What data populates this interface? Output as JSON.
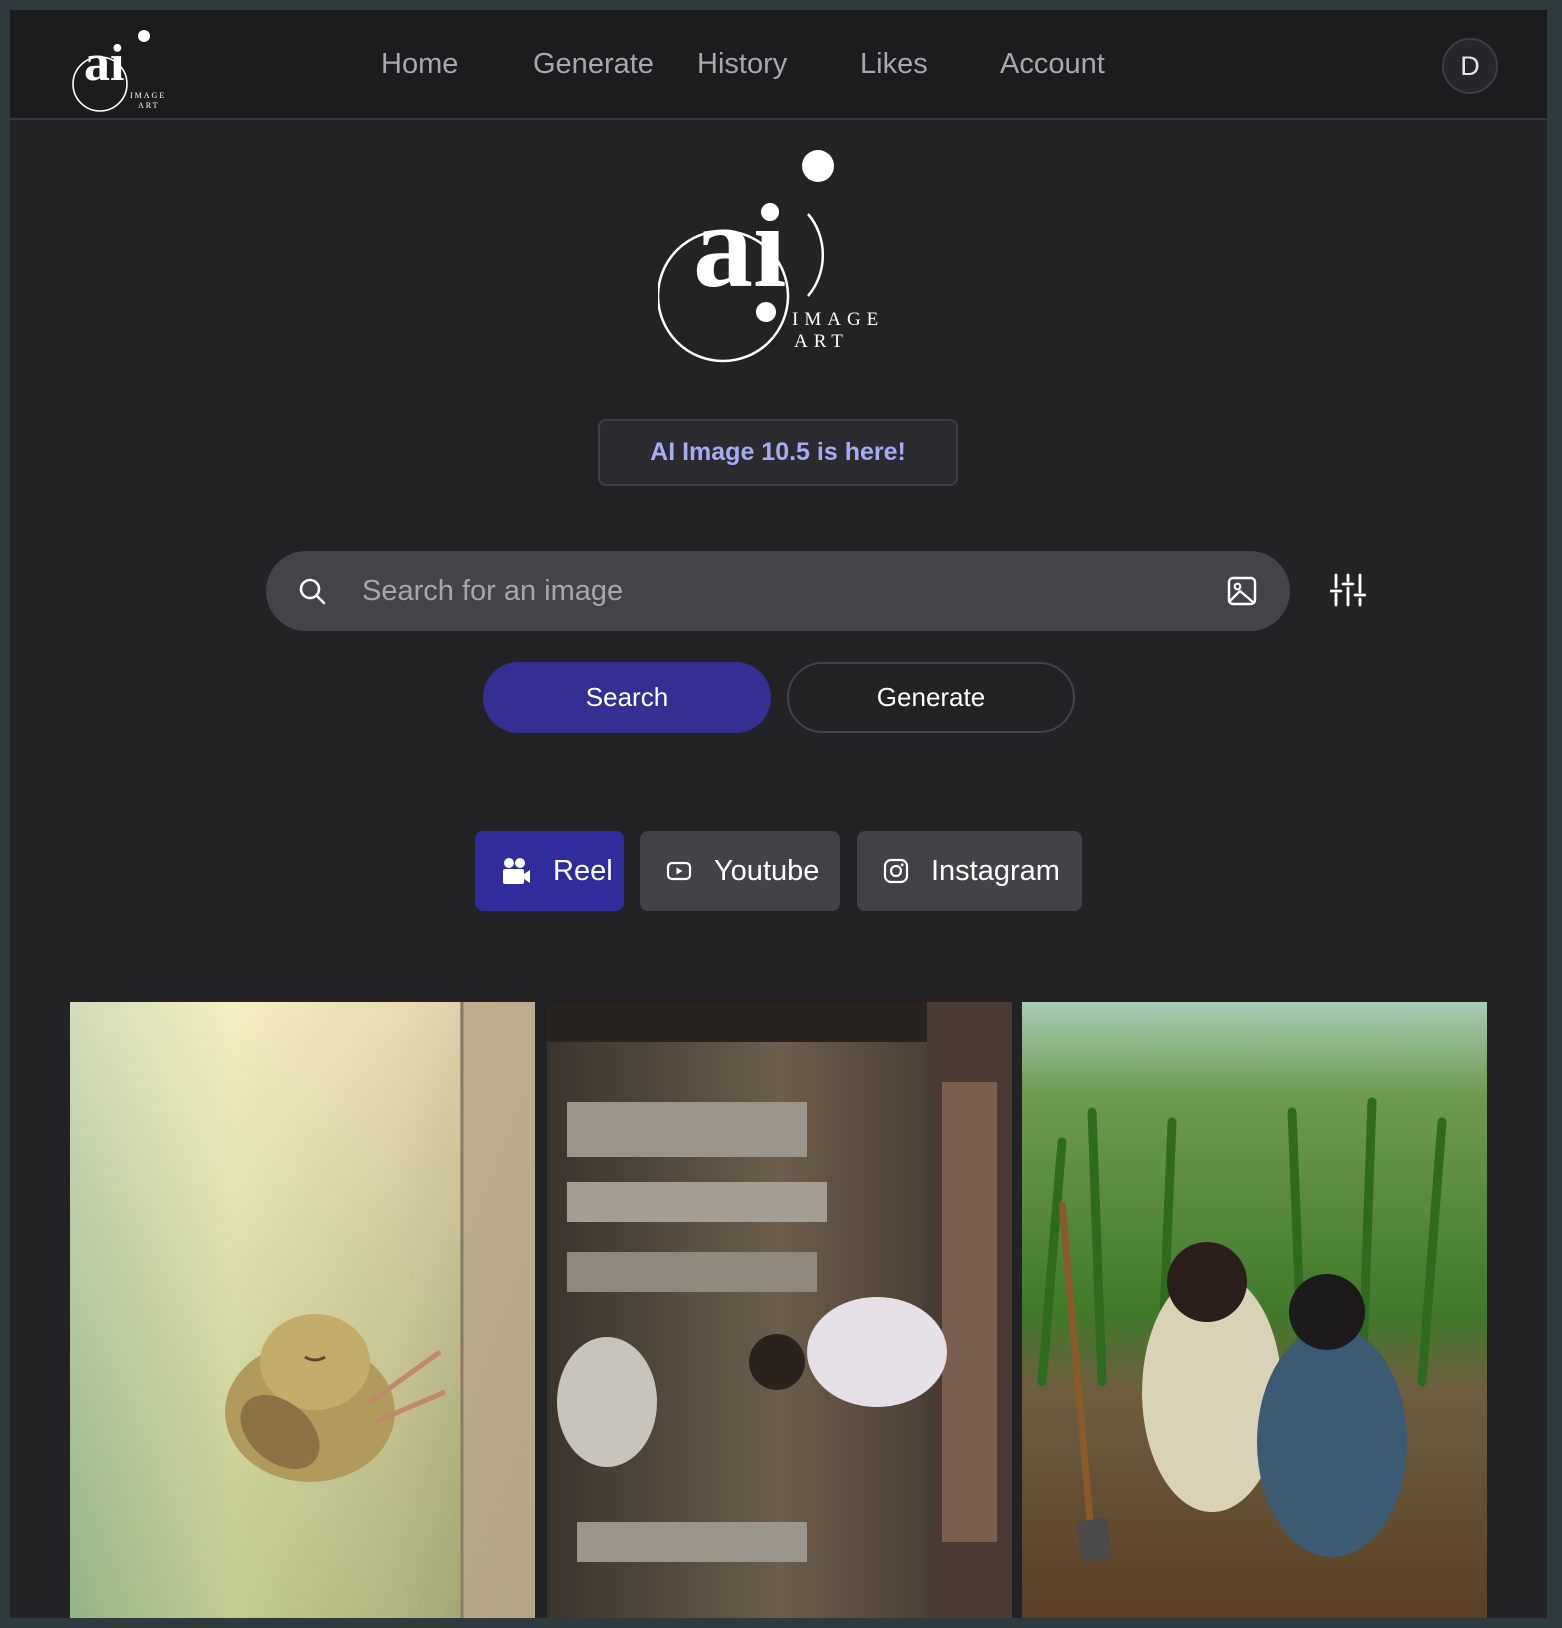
{
  "brand": {
    "logo_mark": "ai",
    "logo_sub_1": "IMAGE",
    "logo_sub_2": "ART"
  },
  "nav": {
    "items": [
      {
        "label": "Home"
      },
      {
        "label": "Generate"
      },
      {
        "label": "History"
      },
      {
        "label": "Likes"
      },
      {
        "label": "Account"
      }
    ],
    "avatar_initial": "D"
  },
  "announcement": "AI Image 10.5 is here!",
  "search": {
    "placeholder": "Search for an image",
    "value": "",
    "search_icon": "search-icon",
    "image_icon": "image-upload-icon",
    "filters_icon": "sliders-icon"
  },
  "actions": {
    "search_label": "Search",
    "generate_label": "Generate"
  },
  "formats": [
    {
      "label": "Reel",
      "icon": "video-camera-icon",
      "active": true
    },
    {
      "label": "Youtube",
      "icon": "youtube-icon",
      "active": false
    },
    {
      "label": "Instagram",
      "icon": "instagram-icon",
      "active": false
    }
  ],
  "gallery": [
    {
      "subject": "sleeping bird clinging to wall"
    },
    {
      "subject": "person praying in ornate mosque (rotated)"
    },
    {
      "subject": "two boys digging in cornfield"
    }
  ],
  "colors": {
    "page_bg": "#232326",
    "nav_bg": "#1c1c1f",
    "accent": "#352f93",
    "announce_text": "#a7acf2"
  }
}
